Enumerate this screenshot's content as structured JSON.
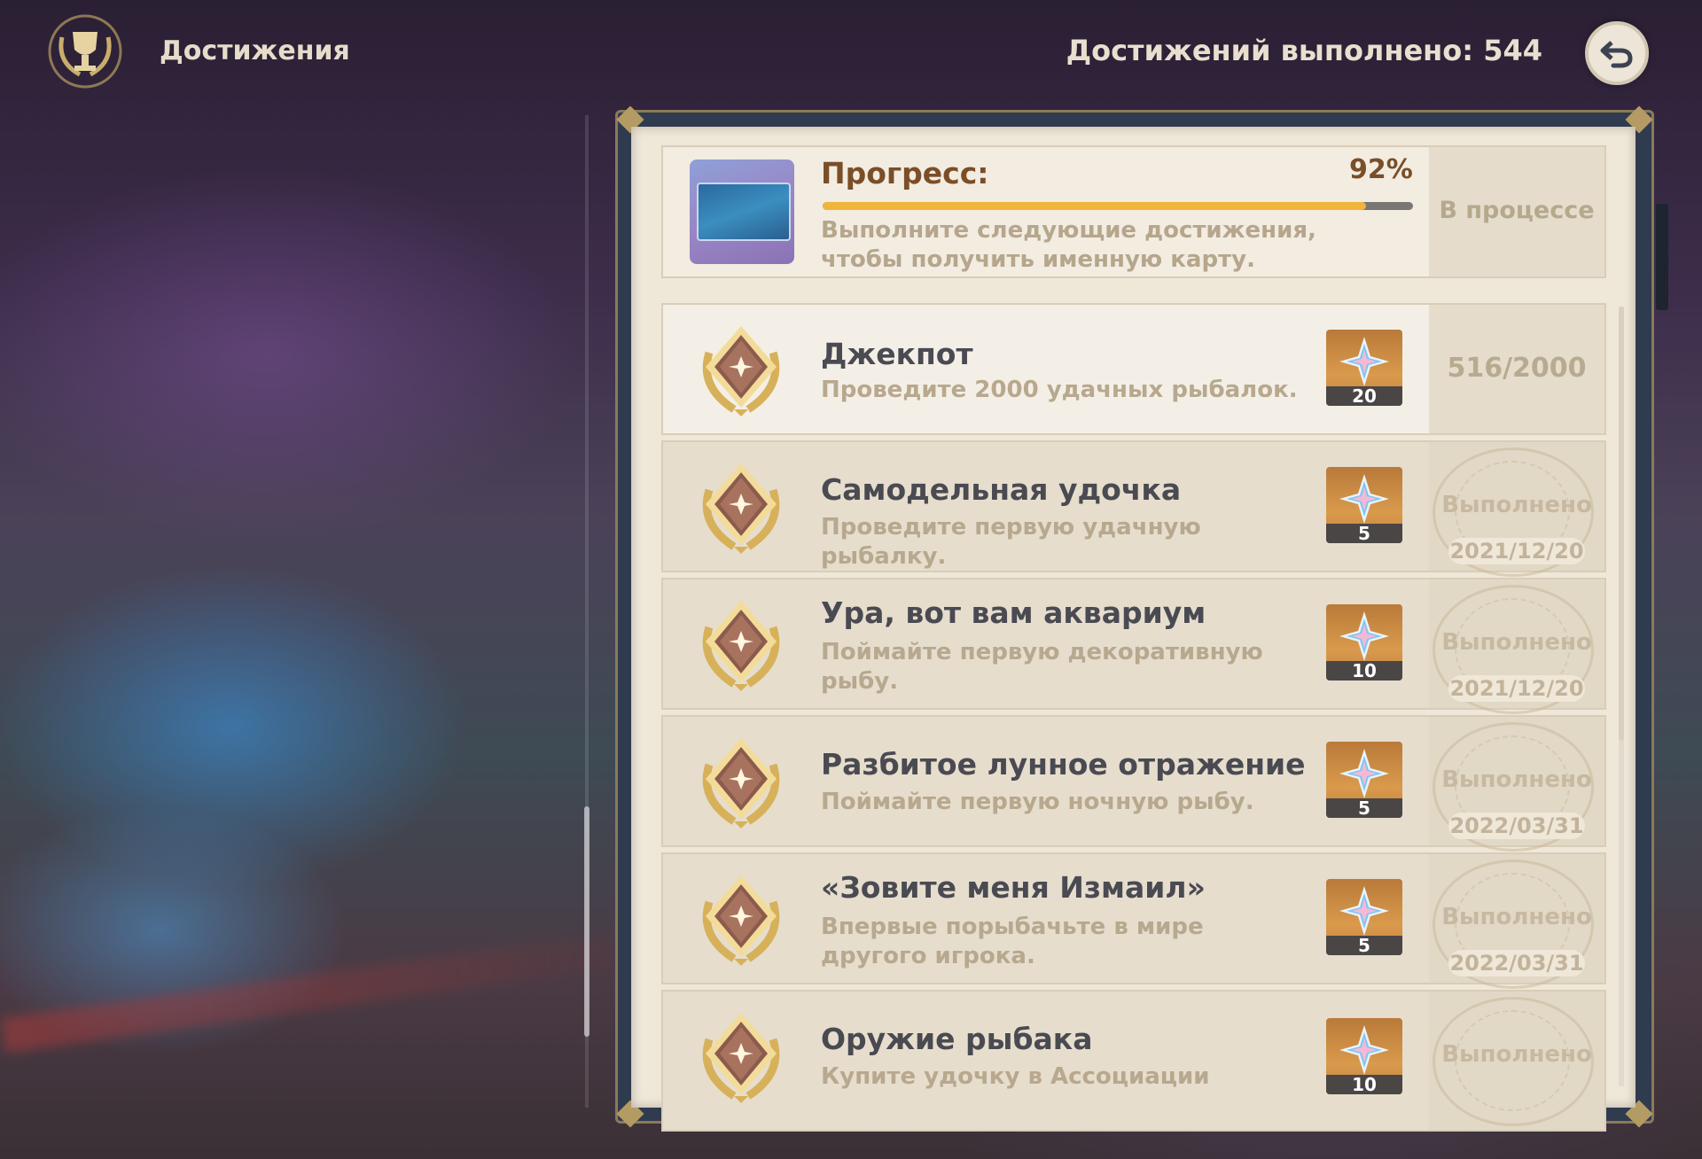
{
  "header": {
    "title": "Достижения",
    "completed_text": "Достижений выполнено: 544",
    "icon": "trophy-icon",
    "back_icon": "back-arrow-icon"
  },
  "progress": {
    "label": "Прогресс:",
    "percent_text": "92%",
    "percent_value": 0.92,
    "description": "Выполните следующие достижения, чтобы получить именную карту.",
    "status": "В процессе"
  },
  "achievements": [
    {
      "title": "Джекпот",
      "description": "Проведите 2000 удачных рыбалок.",
      "reward_qty": "20",
      "status": "516/2000",
      "date": "",
      "completed": false
    },
    {
      "title": "Самодельная удочка",
      "description": "Проведите первую удачную рыбалку.",
      "reward_qty": "5",
      "status": "Выполнено",
      "date": "2021/12/20",
      "completed": true
    },
    {
      "title": "Ура, вот вам аквариум",
      "description": "Поймайте первую декоративную рыбу.",
      "reward_qty": "10",
      "status": "Выполнено",
      "date": "2021/12/20",
      "completed": true
    },
    {
      "title": "Разбитое лунное отражение",
      "description": "Поймайте первую ночную рыбу.",
      "reward_qty": "5",
      "status": "Выполнено",
      "date": "2022/03/31",
      "completed": true
    },
    {
      "title": "«Зовите меня Измаил»",
      "description": "Впервые порыбачьте в мире другого игрока.",
      "reward_qty": "5",
      "status": "Выполнено",
      "date": "2022/03/31",
      "completed": true
    },
    {
      "title": "Оружие рыбака",
      "description": "Купите удочку в Ассоциации",
      "reward_qty": "10",
      "status": "Выполнено",
      "date": "",
      "completed": true
    }
  ],
  "colors": {
    "accent": "#f0b53a",
    "page": "#efe7d8",
    "title_text": "#4a4a52",
    "desc_text": "#b7a88e"
  }
}
